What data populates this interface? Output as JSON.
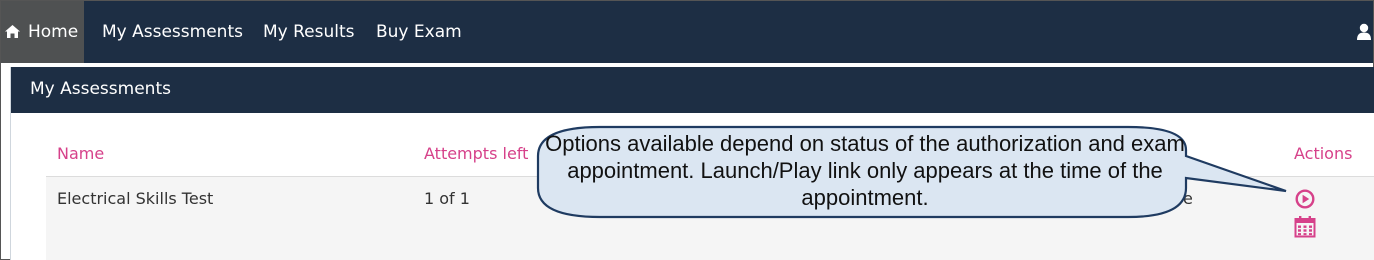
{
  "nav": {
    "items": [
      {
        "label": "Home",
        "icon": "home-icon",
        "active": true
      },
      {
        "label": "My Assessments"
      },
      {
        "label": "My Results"
      },
      {
        "label": "Buy Exam"
      }
    ],
    "user_icon": "user-icon"
  },
  "panel": {
    "title": "My Assessments",
    "columns": [
      "Name",
      "Attempts left",
      "Actions"
    ],
    "rows": [
      {
        "name": "Electrical Skills Test",
        "attempts": "1 of 1",
        "partial_text": "e",
        "actions": [
          "play-icon",
          "calendar-icon"
        ]
      }
    ]
  },
  "callout": {
    "text": "Options available depend on status of the authorization and exam appointment. Launch/Play link only appears at the time of the appointment."
  },
  "colors": {
    "navbar": "#1d2e44",
    "active_tab": "#4f5152",
    "accent": "#d6418a",
    "callout_fill": "#dbe6f2",
    "callout_border": "#1f3b61"
  }
}
